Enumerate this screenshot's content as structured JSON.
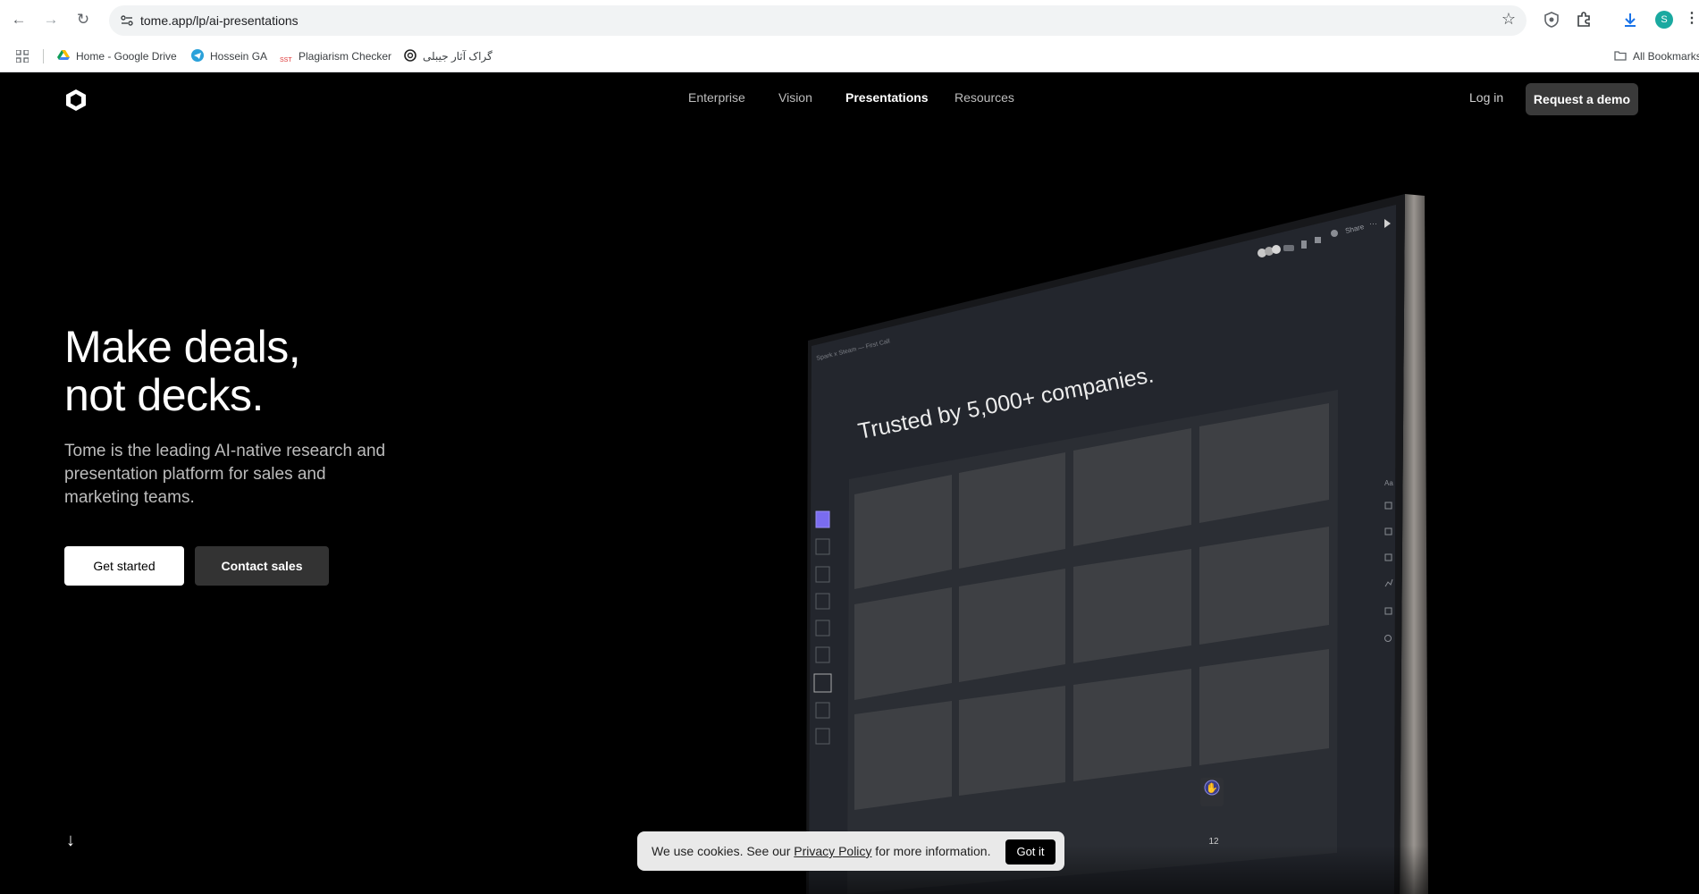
{
  "browser": {
    "url": "tome.app/lp/ai-presentations",
    "bookmarks": [
      {
        "label": "Home - Google Drive"
      },
      {
        "label": "Hossein GA"
      },
      {
        "label": "Plagiarism Checker"
      },
      {
        "label": "گراک آثار جیبلی"
      }
    ],
    "all_bookmarks": "All Bookmarks",
    "profile_initial": "S",
    "icons": [
      "back-icon",
      "forward-icon",
      "reload-icon",
      "site-info-icon",
      "star-icon",
      "extension-icon",
      "puzzle-icon",
      "download-icon",
      "menu-icon"
    ]
  },
  "site": {
    "nav": [
      {
        "label": "Enterprise"
      },
      {
        "label": "Vision"
      },
      {
        "label": "Presentations"
      },
      {
        "label": "Resources"
      }
    ],
    "active_nav": "Presentations",
    "login": "Log in",
    "request_demo": "Request a demo",
    "hero": {
      "headline_line1": "Make deals,",
      "headline_line2": "not decks.",
      "subhead": "Tome is the leading AI-native research and presentation platform for sales and marketing teams.",
      "get_started": "Get started",
      "contact_sales": "Contact sales"
    },
    "mockup": {
      "slide_title": "Trusted by 5,000+ companies.",
      "breadcrumb": "Spark x Steam — First Call",
      "share": "Share",
      "page_number": "12"
    },
    "cookie": {
      "text_before": "We use cookies. See our ",
      "link": "Privacy Policy",
      "text_after": " for more information.",
      "button": "Got it"
    }
  },
  "colors": {
    "page_bg": "#000000",
    "demo_button_bg": "#3a3a3a",
    "screen_bg": "#22252c",
    "card_bg": "#3c3e42"
  }
}
